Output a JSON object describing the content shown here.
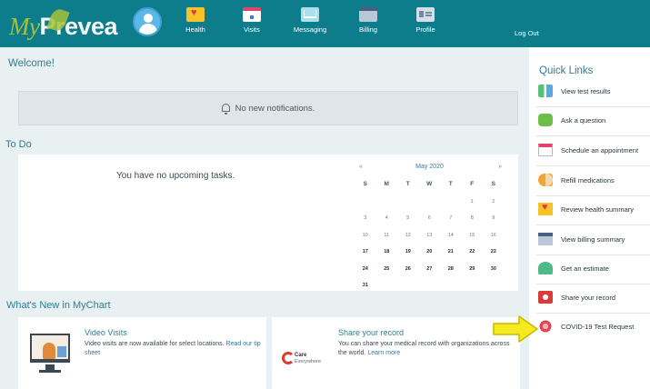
{
  "header": {
    "logo_my": "My",
    "logo_prevea": "Prevea",
    "nav": [
      {
        "label": "Health",
        "icon": "health-heart-icon"
      },
      {
        "label": "Visits",
        "icon": "calendar-icon"
      },
      {
        "label": "Messaging",
        "icon": "envelope-icon"
      },
      {
        "label": "Billing",
        "icon": "credit-card-icon"
      },
      {
        "label": "Profile",
        "icon": "id-card-icon"
      }
    ],
    "logout": "Log Out",
    "accent_color": "#0d7d8c"
  },
  "welcome": {
    "title": "Welcome!",
    "notifications": "No new notifications."
  },
  "todo": {
    "title": "To Do",
    "empty_text": "You have no upcoming tasks."
  },
  "calendar": {
    "prev": "«",
    "next": "»",
    "month": "May 2020",
    "dow": [
      "S",
      "M",
      "T",
      "W",
      "T",
      "F",
      "S"
    ],
    "weeks": [
      [
        "",
        "",
        "",
        "",
        "",
        "1",
        "2"
      ],
      [
        "3",
        "4",
        "5",
        "6",
        "7",
        "8",
        "9"
      ],
      [
        "10",
        "11",
        "12",
        "13",
        "14",
        "15",
        "16"
      ],
      [
        "17",
        "18",
        "19",
        "20",
        "21",
        "22",
        "23"
      ],
      [
        "24",
        "25",
        "26",
        "27",
        "28",
        "29",
        "30"
      ],
      [
        "31",
        "",
        "",
        "",
        "",
        "",
        ""
      ]
    ]
  },
  "whats_new": {
    "title": "What's New in MyChart",
    "cards": [
      {
        "title": "Video Visits",
        "text": "Video visits are now available for select locations.",
        "link": "Read our tip sheet"
      },
      {
        "title": "Share your record",
        "text": "You can share your medical record with organizations across the world.",
        "link": "Learn more",
        "logo_line1": "Care",
        "logo_line2": "Everywhere"
      }
    ]
  },
  "quick_links": {
    "title": "Quick Links",
    "items": [
      {
        "label": "View test results",
        "icon": "test-tube-icon"
      },
      {
        "label": "Ask a question",
        "icon": "chat-bubble-icon"
      },
      {
        "label": "Schedule an appointment",
        "icon": "calendar-icon"
      },
      {
        "label": "Refill medications",
        "icon": "pill-icon"
      },
      {
        "label": "Review health summary",
        "icon": "health-heart-icon"
      },
      {
        "label": "View billing summary",
        "icon": "credit-card-icon"
      },
      {
        "label": "Get an estimate",
        "icon": "estimate-icon"
      },
      {
        "label": "Share your record",
        "icon": "share-record-icon"
      },
      {
        "label": "COVID-19 Test Request",
        "icon": "virus-icon"
      }
    ]
  }
}
